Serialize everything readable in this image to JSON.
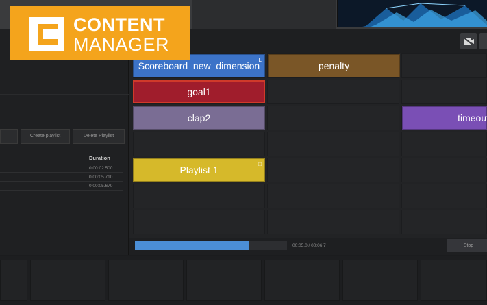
{
  "logo": {
    "line1": "CONTENT",
    "line2": "MANAGER"
  },
  "playlist_buttons": [
    {
      "label": ""
    },
    {
      "label": "Create playlist"
    },
    {
      "label": "Delete Playlist"
    }
  ],
  "playlist_table": {
    "duration_header": "Duration",
    "rows": [
      "0:00:02.500",
      "0:00:05.710",
      "0:00:05.670"
    ]
  },
  "tiles": [
    {
      "label": "Scoreboard_new_dimension",
      "corner": "L",
      "color": "#3c73c8"
    },
    {
      "label": "penalty",
      "color": "#7a5627"
    },
    {
      "label": "goal1",
      "color": "#a01d2c"
    },
    {
      "label": "clap2",
      "color": "#7a6d94"
    },
    {
      "label": "timeout",
      "color": "#7a4fb5"
    },
    {
      "label": "Playlist 1",
      "corner": "□",
      "color": "#d6b92a"
    }
  ],
  "progress": {
    "fraction": 0.75,
    "time": "00:05.0 / 00:06.7"
  },
  "stop_label": "Stop"
}
